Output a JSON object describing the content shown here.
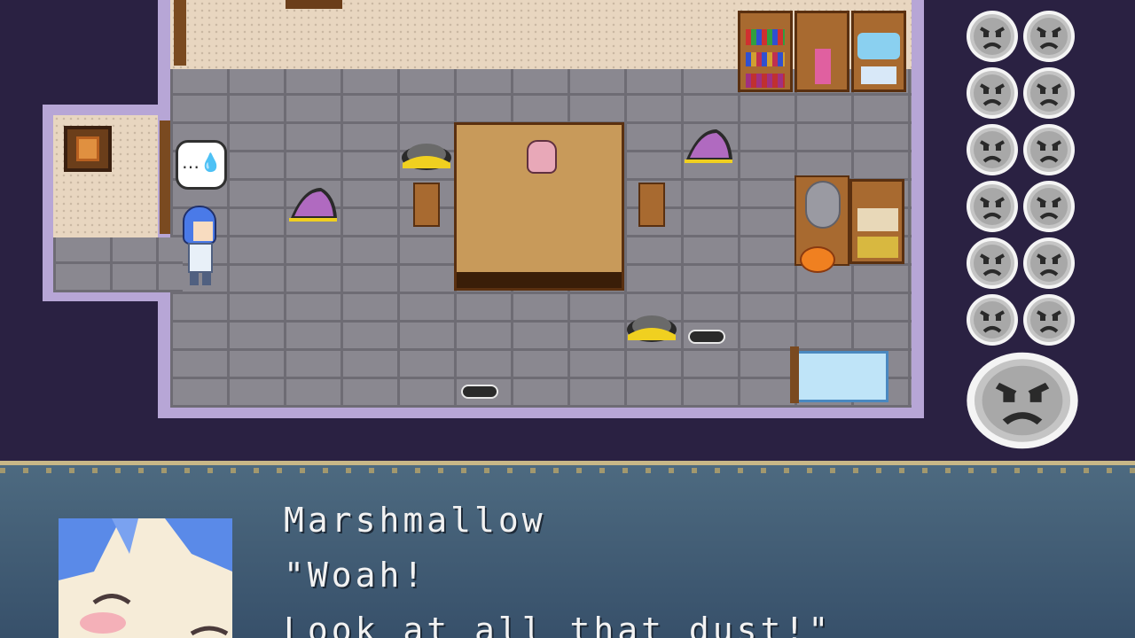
{
  "dialogue": {
    "speaker": "Marshmallow",
    "lines": [
      "\"Woah!",
      "Look at all that dust!\""
    ]
  },
  "status": {
    "small_faces": 12,
    "big_faces": 1,
    "face_mood": "angry"
  },
  "scene": {
    "emote_bubble": "…💧"
  },
  "colors": {
    "background": "#2a2142",
    "border": "#b7a6d6",
    "dialogue_box": "#4d6a80"
  }
}
